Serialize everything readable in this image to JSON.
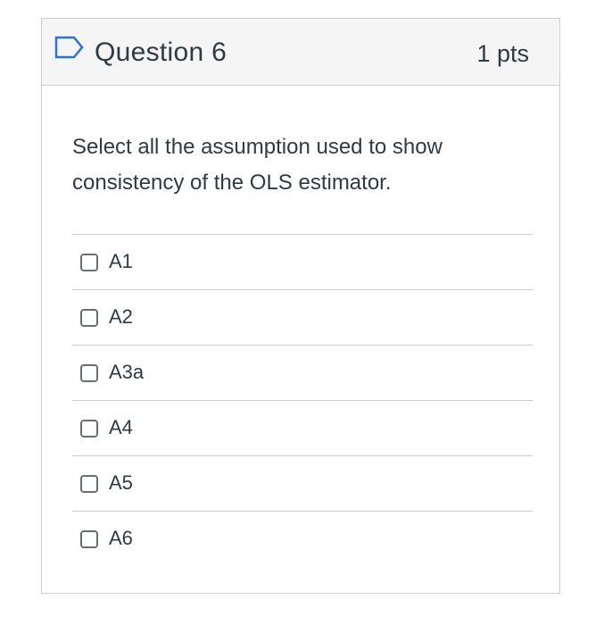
{
  "question": {
    "title": "Question 6",
    "points": "1 pts",
    "text": "Select all the assumption used to show consistency of the OLS estimator.",
    "flag_icon": "bookmark-flag-icon",
    "accent_color": "#2d72d9"
  },
  "answers": [
    {
      "label": "A1",
      "checked": false
    },
    {
      "label": "A2",
      "checked": false
    },
    {
      "label": "A3a",
      "checked": false
    },
    {
      "label": "A4",
      "checked": false
    },
    {
      "label": "A5",
      "checked": false
    },
    {
      "label": "A6",
      "checked": false
    }
  ]
}
